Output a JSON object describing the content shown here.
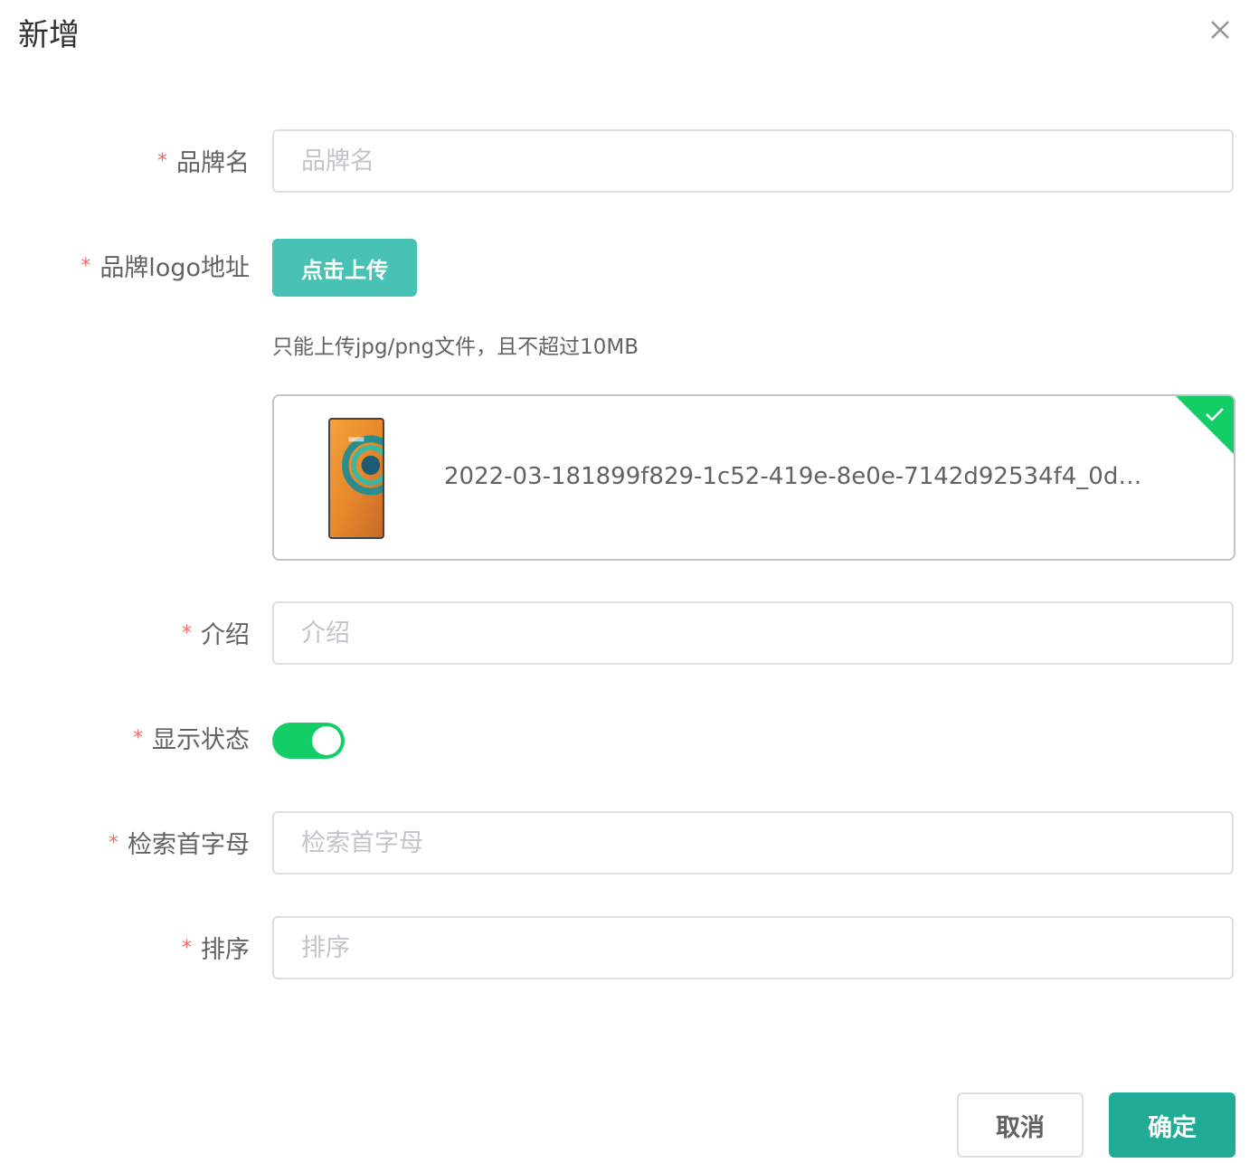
{
  "dialog": {
    "title": "新增",
    "close_icon": "close-icon"
  },
  "form": {
    "brand_name": {
      "label": "品牌名",
      "placeholder": "品牌名",
      "value": ""
    },
    "logo": {
      "label": "品牌logo地址",
      "upload_label": "点击上传",
      "tip": "只能上传jpg/png文件，且不超过10MB",
      "file_name": "2022-03-181899f829-1c52-419e-8e0e-7142d92534f4_0d4...",
      "status_icon": "check-icon"
    },
    "description": {
      "label": "介绍",
      "placeholder": "介绍",
      "value": ""
    },
    "show_status": {
      "label": "显示状态",
      "enabled": true
    },
    "first_letter": {
      "label": "检索首字母",
      "placeholder": "检索首字母",
      "value": ""
    },
    "sort": {
      "label": "排序",
      "placeholder": "排序",
      "value": ""
    }
  },
  "footer": {
    "cancel_label": "取消",
    "confirm_label": "确定"
  },
  "colors": {
    "primary": "#1fab96",
    "upload_button": "#48c2b4",
    "switch_on": "#13ce66",
    "required_mark": "#f56c6c"
  }
}
